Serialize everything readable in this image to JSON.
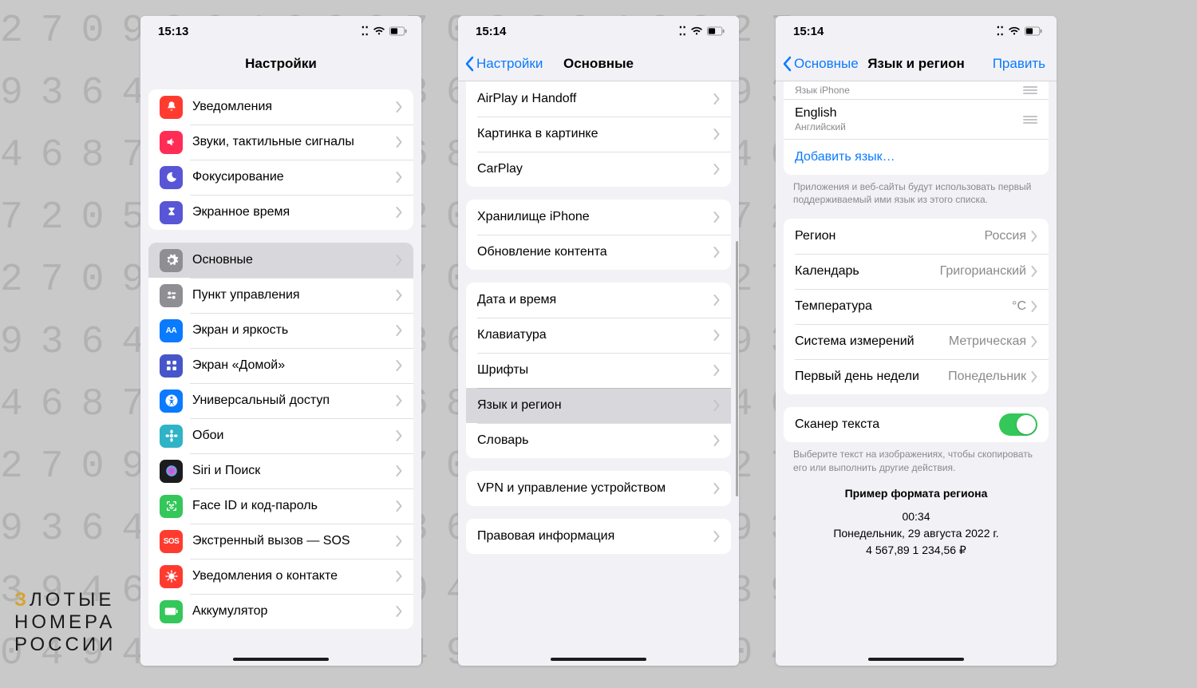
{
  "background_numbers": "27093640027093640027\n93640117893640117893\n46872539546872539546\n72058642772058642772\n27093640027093640027\n93640117893640117893\n46872539546872539546\n27093640027093640027\n93640117893640117893\n39461588039461588039\n04946910904946910904",
  "watermark": {
    "line1_a": "З",
    "line1_b": "ЛОТЫЕ",
    "line2": "НОМЕРА",
    "line3": "РОССИИ"
  },
  "phone1": {
    "time": "15:13",
    "title": "Настройки",
    "group1": [
      {
        "label": "Уведомления",
        "color": "#ff3b30",
        "glyph": "bell-icon"
      },
      {
        "label": "Звуки, тактильные сигналы",
        "color": "#ff2d55",
        "glyph": "speaker-icon"
      },
      {
        "label": "Фокусирование",
        "color": "#5856d6",
        "glyph": "moon-icon"
      },
      {
        "label": "Экранное время",
        "color": "#5856d6",
        "glyph": "hourglass-icon"
      }
    ],
    "group2": [
      {
        "label": "Основные",
        "color": "#8e8e93",
        "glyph": "gear-icon",
        "selected": true
      },
      {
        "label": "Пункт управления",
        "color": "#8e8e93",
        "glyph": "switches-icon"
      },
      {
        "label": "Экран и яркость",
        "color": "#0a7aff",
        "glyph": "AA"
      },
      {
        "label": "Экран «Домой»",
        "color": "#4656c9",
        "glyph": "grid-icon"
      },
      {
        "label": "Универсальный доступ",
        "color": "#0a7aff",
        "glyph": "accessibility-icon"
      },
      {
        "label": "Обои",
        "color": "#2fb3c7",
        "glyph": "flower-icon"
      },
      {
        "label": "Siri и Поиск",
        "color": "#1c1c1e",
        "glyph": "siri-icon"
      },
      {
        "label": "Face ID и код-пароль",
        "color": "#34c759",
        "glyph": "faceid-icon"
      },
      {
        "label": "Экстренный вызов — SOS",
        "color": "#ff3b30",
        "glyph": "SOS"
      },
      {
        "label": "Уведомления о контакте",
        "color": "#ff3b30",
        "glyph": "virus-icon"
      },
      {
        "label": "Аккумулятор",
        "color": "#34c759",
        "glyph": "battery-icon"
      }
    ]
  },
  "phone2": {
    "time": "15:14",
    "back": "Настройки",
    "title": "Основные",
    "group1": [
      "AirPlay и Handoff",
      "Картинка в картинке",
      "CarPlay"
    ],
    "group2": [
      "Хранилище iPhone",
      "Обновление контента"
    ],
    "group3": [
      "Дата и время",
      "Клавиатура",
      "Шрифты",
      "Язык и регион",
      "Словарь"
    ],
    "group4": [
      "VPN и управление устройством"
    ],
    "group5": [
      "Правовая информация"
    ],
    "selected": "Язык и регион"
  },
  "phone3": {
    "time": "15:14",
    "back": "Основные",
    "title": "Язык и регион",
    "right": "Править",
    "lang_header": "Язык iPhone",
    "languages": [
      {
        "title": "English",
        "sub": "Английский"
      }
    ],
    "add_lang": "Добавить язык…",
    "lang_footer": "Приложения и веб-сайты будут использовать первый поддерживаемый ими язык из этого списка.",
    "prefs": [
      {
        "label": "Регион",
        "detail": "Россия"
      },
      {
        "label": "Календарь",
        "detail": "Григорианский"
      },
      {
        "label": "Температура",
        "detail": "°C"
      },
      {
        "label": "Система измерений",
        "detail": "Метрическая"
      },
      {
        "label": "Первый день недели",
        "detail": "Понедельник"
      }
    ],
    "scanner": {
      "label": "Сканер текста",
      "on": true
    },
    "scanner_footer": "Выберите текст на изображениях, чтобы скопировать его или выполнить другие действия.",
    "example": {
      "header": "Пример формата региона",
      "line1": "00:34",
      "line2": "Понедельник, 29 августа 2022 г.",
      "line3": "4 567,89 1 234,56 ₽"
    }
  }
}
